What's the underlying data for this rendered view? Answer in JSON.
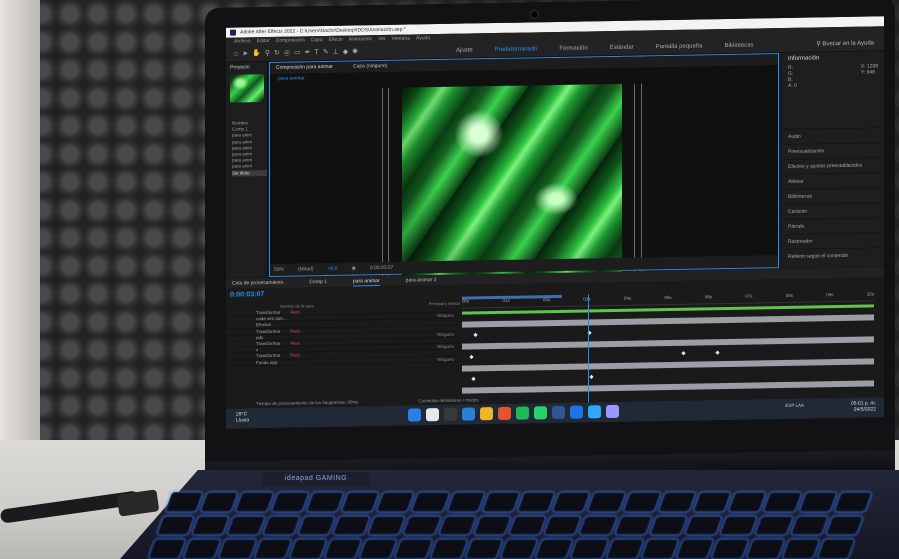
{
  "app": {
    "window_title": "Adobe After Effects 2022 - C:\\Users\\Nacho\\Desktop\\IDDS\\Animación.aep *",
    "menu": [
      "Archivo",
      "Editar",
      "Composición",
      "Capa",
      "Efecto",
      "Animación",
      "Ver",
      "Ventana",
      "Ayuda"
    ],
    "ajuste_label": "Ajuste",
    "workspaces": [
      "Predeterminado",
      "Formación",
      "Estándar",
      "Pantalla pequeña",
      "Bibliotecas"
    ],
    "active_workspace": "Predeterminado",
    "help_search": "Buscar en la Ayuda",
    "accent_color": "#2d8ceb"
  },
  "project_panel": {
    "tab": "Proyecto",
    "column_header": "Nombre",
    "items": [
      "Comp 1",
      "para anim",
      "para anim",
      "para anim",
      "para anim",
      "para anim",
      "para anim",
      "Sin título"
    ],
    "selected_index": 7
  },
  "composition_panel": {
    "tab": "Composición para animar",
    "layer_tab": "Capa (ninguno)",
    "breadcrumb": "para animar",
    "zoom": "50%",
    "resolution": "(Mitad)",
    "timecode": "0:00:03:07",
    "frame_offset": "+0,0"
  },
  "info_panel": {
    "title": "Información",
    "r": "R:",
    "g": "G:",
    "b": "B:",
    "a": "A: 0",
    "x": "X: 1298",
    "y": "Y: 948",
    "panels": [
      "Audio",
      "Previsualización",
      "Efectos y ajustes preestablecidos",
      "Alinear",
      "Bibliotecas",
      "Carácter",
      "Párrafo",
      "Rastreador",
      "Relleno según el contenido"
    ]
  },
  "timeline": {
    "tabs": [
      "Cola de procesamiento",
      "Comp 1",
      "para animar",
      "para animar 2"
    ],
    "active_tab": "para animar",
    "timecode": "0:00:03:07",
    "col_source": "Nombre de la capa",
    "col_parent": "Principal y enlace",
    "layers": [
      {
        "name": "Transformar",
        "mode": "Rest.",
        "parent": ""
      },
      {
        "name": "cada vez que...",
        "mode": "",
        "parent": "Ninguno"
      },
      {
        "name": "Efectos",
        "mode": "",
        "parent": ""
      },
      {
        "name": "Transformar",
        "mode": "Rest.",
        "parent": ""
      },
      {
        "name": "nds",
        "mode": "",
        "parent": "Ninguno"
      },
      {
        "name": "Transformar",
        "mode": "Rest.",
        "parent": ""
      },
      {
        "name": "x",
        "mode": "",
        "parent": "Ninguno"
      },
      {
        "name": "Transformar",
        "mode": "Rest.",
        "parent": ""
      },
      {
        "name": "Fondo app",
        "mode": "",
        "parent": "Ninguno"
      }
    ],
    "ruler": [
      "00s",
      "01s",
      "02s",
      "03s",
      "04s",
      "05s",
      "06s",
      "07s",
      "08s",
      "09s",
      "10s"
    ],
    "render_time": "Tiempo de procesamiento de los fotogramas: 80ms",
    "toggle_label": "Conmutar definidores / modos"
  },
  "taskbar": {
    "weather_temp": "28°C",
    "weather_desc": "Lluvia",
    "icon_colors": [
      "#2a7de1",
      "#e8e8e8",
      "#3a3a3a",
      "#2c7fd6",
      "#f0b429",
      "#e3542b",
      "#1db954",
      "#25d366",
      "#2b5797",
      "#1b73e8",
      "#31a8ff",
      "#9999ff"
    ],
    "lang": "ESP LAA",
    "time": "05:01 p. m.",
    "date": "24/5/2022"
  },
  "laptop": {
    "brand": "ideapad GAMING"
  }
}
